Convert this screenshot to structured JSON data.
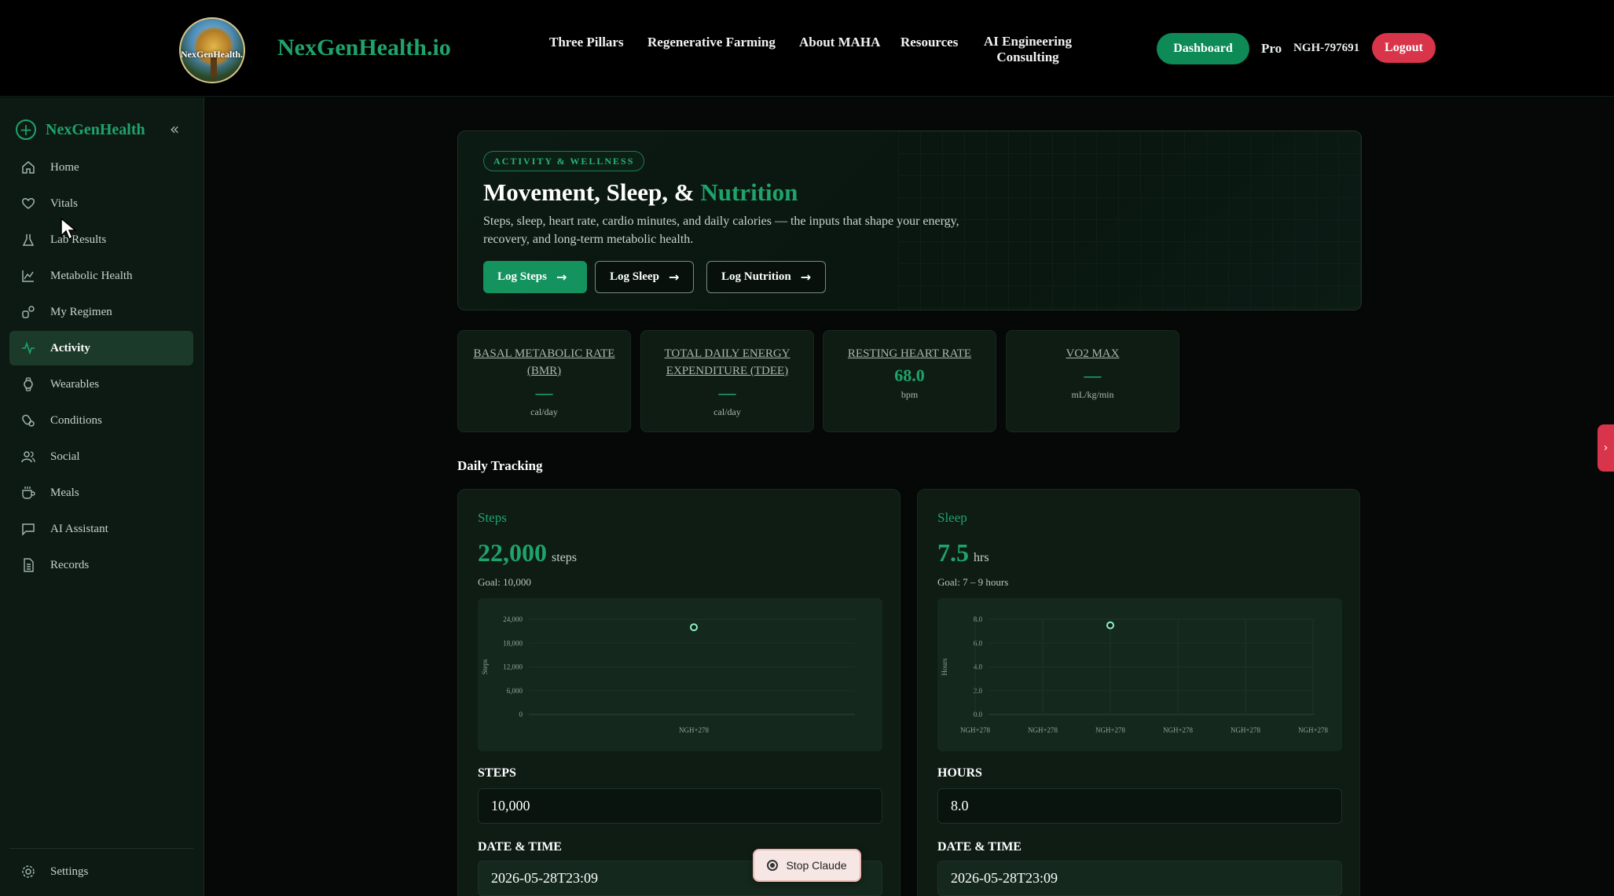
{
  "header": {
    "logo_text": "NexGenHealth.io",
    "brand": "NexGenHealth.io",
    "nav": [
      "Three Pillars",
      "Regenerative Farming",
      "About MAHA",
      "Resources",
      "AI Engineering",
      "Consulting"
    ],
    "dashboard_label": "Dashboard",
    "plan": "Pro",
    "user_id": "NGH-797691",
    "logout_label": "Logout"
  },
  "sidebar": {
    "brand": "NexGenHealth",
    "items": [
      {
        "label": "Home",
        "icon": "home-icon"
      },
      {
        "label": "Vitals",
        "icon": "heart-icon"
      },
      {
        "label": "Lab Results",
        "icon": "flask-icon"
      },
      {
        "label": "Metabolic Health",
        "icon": "chart-line-icon"
      },
      {
        "label": "My Regimen",
        "icon": "regimen-icon"
      },
      {
        "label": "Activity",
        "icon": "activity-icon"
      },
      {
        "label": "Wearables",
        "icon": "watch-icon"
      },
      {
        "label": "Conditions",
        "icon": "conditions-icon"
      },
      {
        "label": "Social",
        "icon": "users-icon"
      },
      {
        "label": "Meals",
        "icon": "cup-icon"
      },
      {
        "label": "AI Assistant",
        "icon": "chat-icon"
      },
      {
        "label": "Records",
        "icon": "document-icon"
      }
    ],
    "active": "Activity",
    "settings_label": "Settings"
  },
  "hero": {
    "pill": "ACTIVITY & WELLNESS",
    "title_main": "Movement, Sleep, & ",
    "title_accent": "Nutrition",
    "subtitle": "Steps, sleep, heart rate, cardio minutes, and daily calories — the inputs that shape your energy, recovery, and long-term metabolic health.",
    "buttons": [
      "Log Steps",
      "Log Sleep",
      "Log Nutrition"
    ]
  },
  "stats": [
    {
      "title": "BASAL METABOLIC RATE (BMR)",
      "value": "—",
      "unit": "cal/day"
    },
    {
      "title": "TOTAL DAILY ENERGY EXPENDITURE (TDEE)",
      "value": "—",
      "unit": "cal/day"
    },
    {
      "title": "RESTING HEART RATE",
      "value": "68.0",
      "unit": "bpm"
    },
    {
      "title": "VO2 MAX",
      "value": "—",
      "unit": "mL/kg/min"
    }
  ],
  "daily_tracking": {
    "heading": "Daily Tracking",
    "steps": {
      "title": "Steps",
      "value": "22,000",
      "unit": "steps",
      "goal": "Goal: 10,000",
      "field_label": "STEPS",
      "field_value": "10,000",
      "date_label": "DATE & TIME",
      "date_value": "2026-05-28T23:09"
    },
    "sleep": {
      "title": "Sleep",
      "value": "7.5",
      "unit": "hrs",
      "goal": "Goal: 7 – 9 hours",
      "field_label": "HOURS",
      "field_value": "8.0",
      "date_label": "DATE & TIME",
      "date_value": "2026-05-28T23:09"
    }
  },
  "chart_data": [
    {
      "type": "scatter",
      "ylabel": "Steps",
      "yticks": [
        "24,000",
        "18,000",
        "12,000",
        "6,000",
        "0"
      ],
      "ylim": [
        0,
        24000
      ],
      "x": [
        "NGH+278"
      ],
      "series": [
        {
          "values": [
            22000
          ]
        }
      ],
      "grid": true
    },
    {
      "type": "scatter",
      "ylabel": "Hours",
      "yticks": [
        "8.0",
        "6.0",
        "4.0",
        "2.0",
        "0.0"
      ],
      "ylim": [
        0,
        8
      ],
      "x": [
        "NGH+278",
        "NGH+278",
        "NGH+278",
        "NGH+278",
        "NGH+278",
        "NGH+278"
      ],
      "series": [
        {
          "values": [
            null,
            null,
            7.5,
            null,
            null,
            null
          ]
        }
      ],
      "grid": true
    }
  ],
  "overlay": {
    "stop_label": "Stop Claude",
    "side_tab": "›"
  },
  "colors": {
    "accent": "#1fa36a",
    "logout": "#d8344a",
    "dashboard": "#0e8a57"
  }
}
